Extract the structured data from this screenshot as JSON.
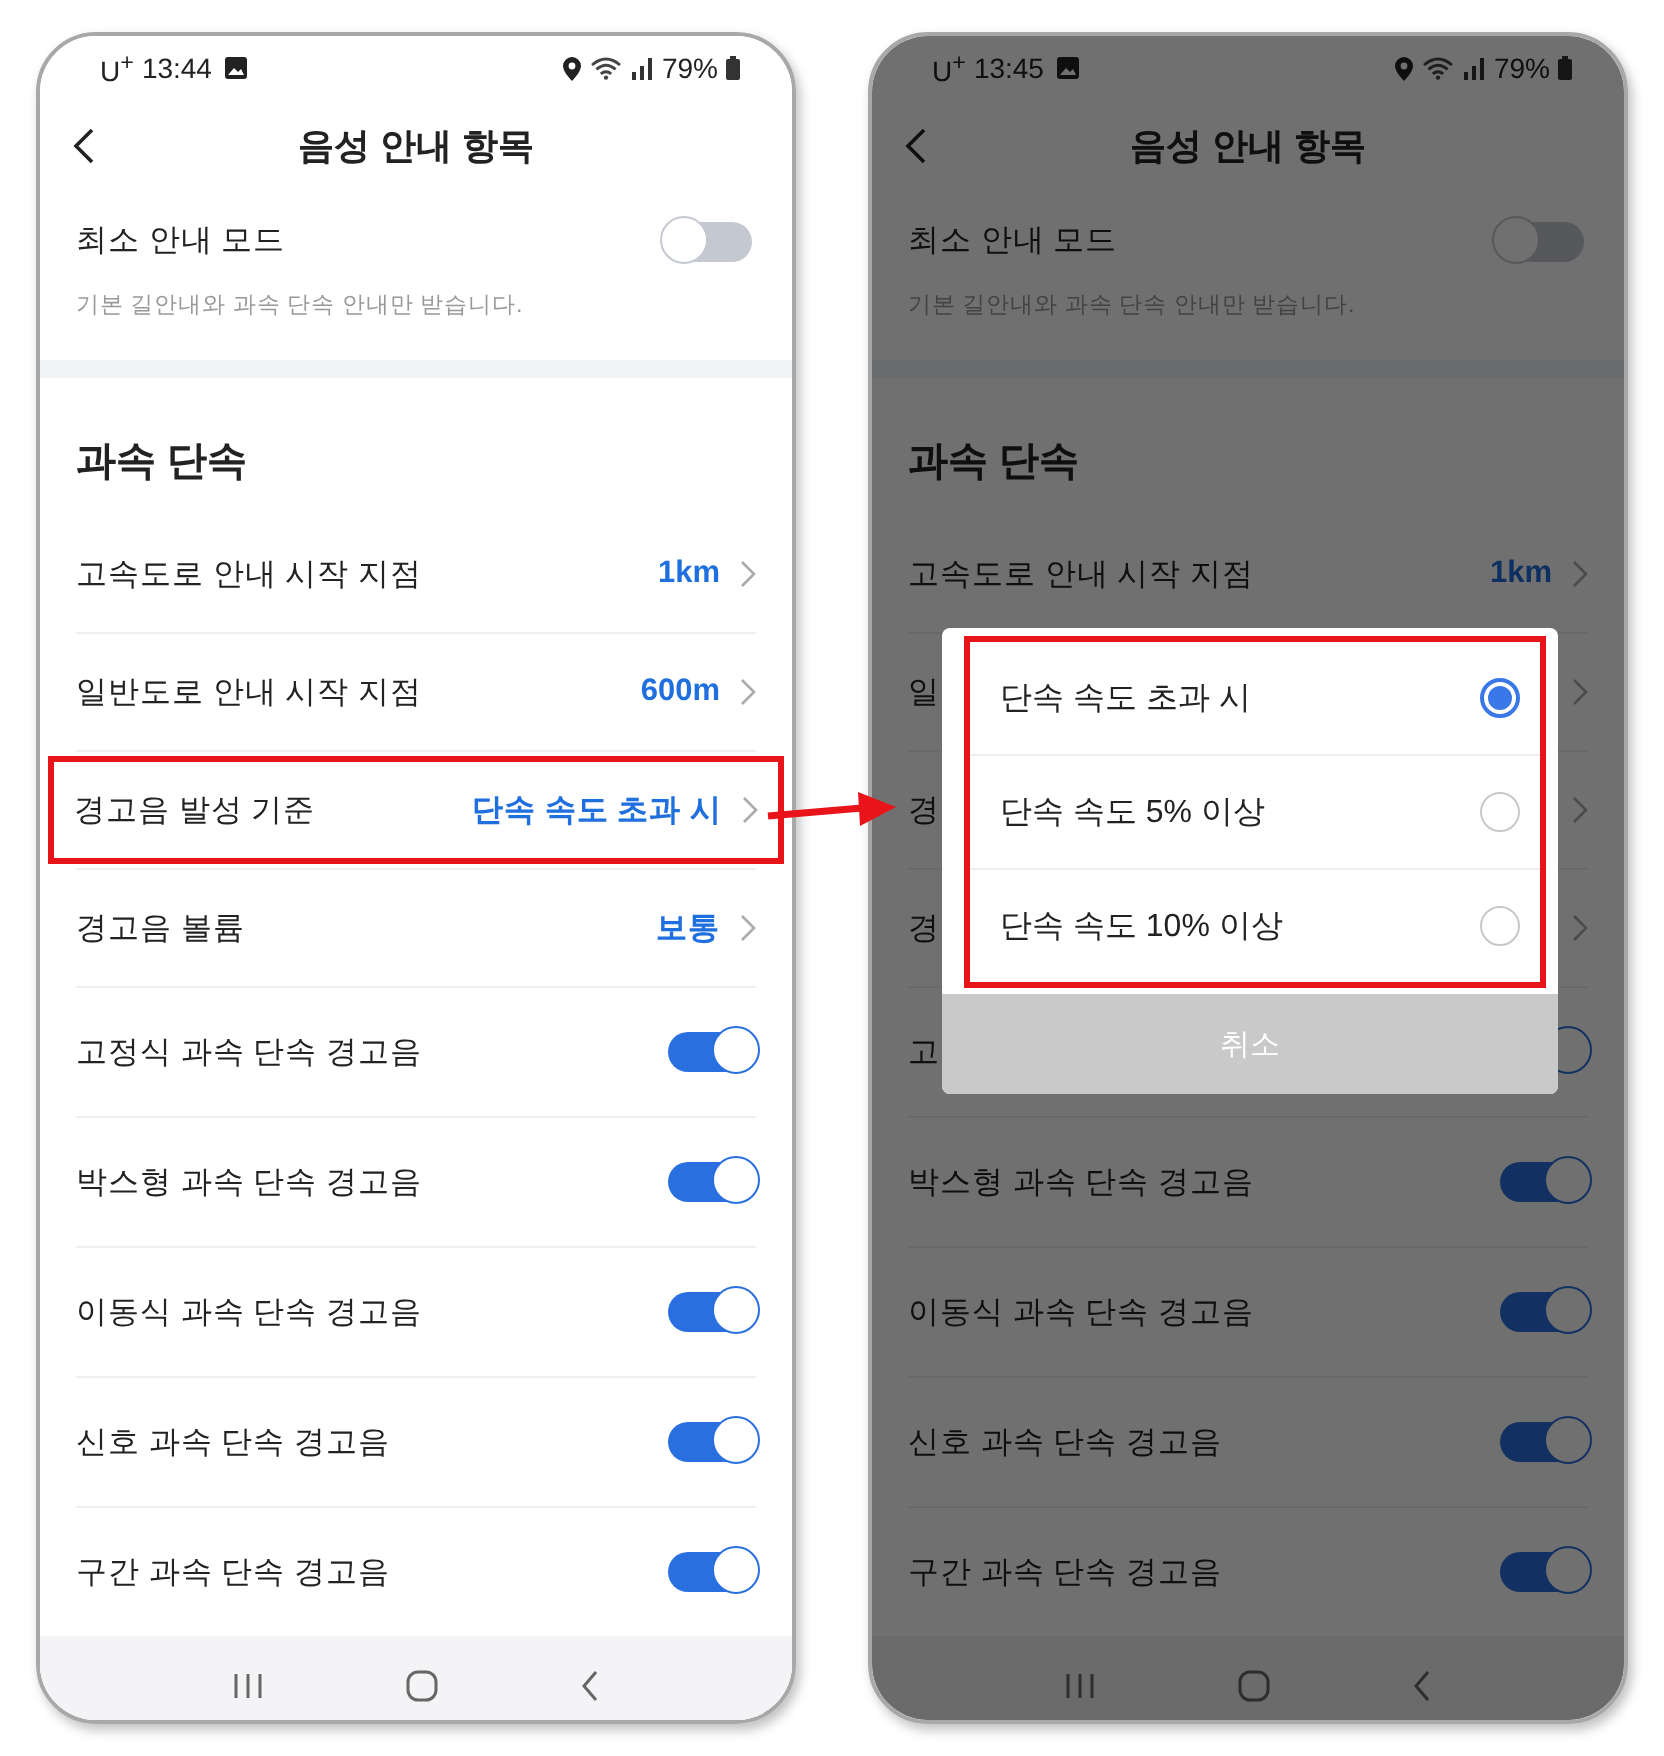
{
  "phones": [
    {
      "dimmed": false,
      "status_bar": {
        "carrier": "U$^{+}$",
        "time": "13:44",
        "battery": "79%"
      },
      "header": {
        "title": "음성 안내 항목"
      },
      "minimal_mode": {
        "label": "최소 안내 모드",
        "on": false,
        "description": "기본 길안내와 과속 단속 안내만 받습니다."
      },
      "section_title": "과속 단속",
      "rows": [
        {
          "kind": "link",
          "label": "고속도로 안내 시작 지점",
          "value": "1km",
          "annotated": false
        },
        {
          "kind": "link",
          "label": "일반도로 안내 시작 지점",
          "value": "600m",
          "annotated": false
        },
        {
          "kind": "link",
          "label": "경고음 발성 기준",
          "value": "단속 속도 초과 시",
          "annotated": true
        },
        {
          "kind": "link",
          "label": "경고음 볼륨",
          "value": "보통",
          "annotated": false
        },
        {
          "kind": "toggle",
          "label": "고정식 과속 단속 경고음",
          "on": true
        },
        {
          "kind": "toggle",
          "label": "박스형 과속 단속 경고음",
          "on": true
        },
        {
          "kind": "toggle",
          "label": "이동식 과속 단속 경고음",
          "on": true
        },
        {
          "kind": "toggle",
          "label": "신호 과속 단속 경고음",
          "on": true
        },
        {
          "kind": "toggle",
          "label": "구간 과속 단속 경고음",
          "on": true
        }
      ]
    },
    {
      "dimmed": true,
      "status_bar": {
        "carrier": "U$^{+}$",
        "time": "13:45",
        "battery": "79%"
      },
      "header": {
        "title": "음성 안내 항목"
      },
      "minimal_mode": {
        "label": "최소 안내 모드",
        "on": false,
        "description": "기본 길안내와 과속 단속 안내만 받습니다."
      },
      "section_title": "과속 단속",
      "rows": [
        {
          "kind": "link",
          "label": "고속도로 안내 시작 지점",
          "value": "1km",
          "annotated": false
        },
        {
          "kind": "link",
          "label": "일",
          "annotated": false
        },
        {
          "kind": "link",
          "label": "경",
          "annotated": false
        },
        {
          "kind": "link",
          "label": "경",
          "annotated": false
        },
        {
          "kind": "toggle",
          "label": "고",
          "on": true
        },
        {
          "kind": "toggle",
          "label": "박스형 과속 단속 경고음",
          "on": true
        },
        {
          "kind": "toggle",
          "label": "이동식 과속 단속 경고음",
          "on": true
        },
        {
          "kind": "toggle",
          "label": "신호 과속 단속 경고음",
          "on": true
        },
        {
          "kind": "toggle",
          "label": "구간 과속 단속 경고음",
          "on": true
        }
      ],
      "dialog": {
        "annotated": true,
        "options": [
          {
            "label": "단속 속도 초과 시",
            "selected": true
          },
          {
            "label": "단속 속도 5% 이상",
            "selected": false
          },
          {
            "label": "단속 속도 10% 이상",
            "selected": false
          }
        ],
        "cancel": "취소"
      }
    }
  ]
}
